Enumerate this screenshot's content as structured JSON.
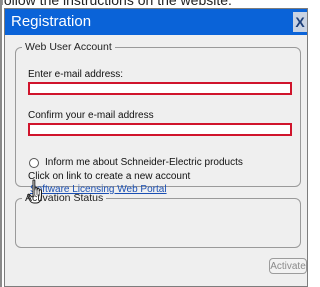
{
  "background": {
    "instruction_fragment": "follow the instructions on the website."
  },
  "dialog": {
    "title": "Registration",
    "close_label": "X",
    "web_user_account": {
      "legend": "Web User Account",
      "email_label": "Enter e-mail address:",
      "email_value": "",
      "confirm_label": "Confirm your e-mail address",
      "confirm_value": "",
      "inform_label": "Inform me about Schneider-Electric products",
      "inform_checked": false,
      "create_account_text": "Click on link to create a new account",
      "portal_link": "Software Licensing Web Portal"
    },
    "activation_status": {
      "legend": "Activation Status",
      "content": ""
    },
    "activate_label": "Activate",
    "activate_enabled": false
  },
  "colors": {
    "titlebar": "#0a63d8",
    "field_error_border": "#d0142c",
    "link": "#1a4fb3",
    "dialog_bg": "#efefef"
  },
  "icons": {
    "cursor": "hand-pointer-icon"
  }
}
